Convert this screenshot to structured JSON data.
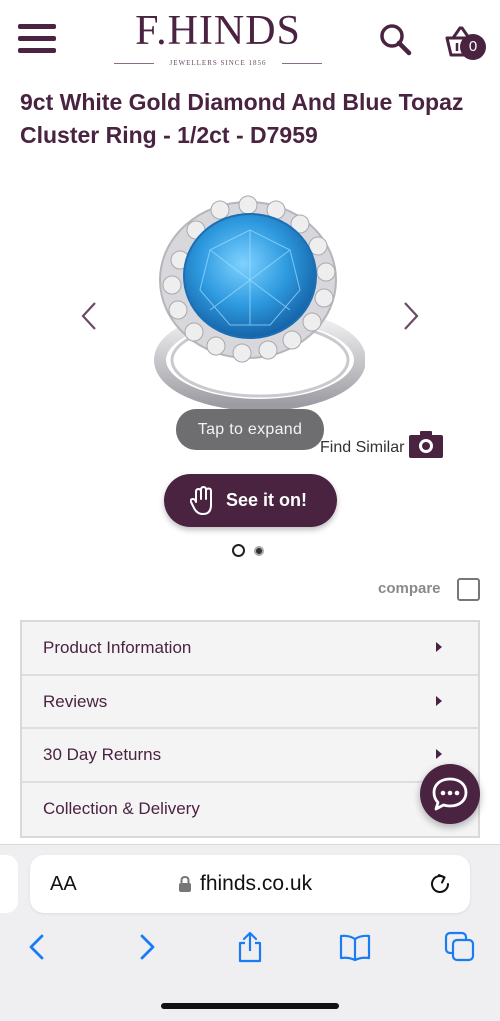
{
  "header": {
    "logo_main": "F.HINDS",
    "logo_sub": "JEWELLERS SINCE 1856",
    "basket_count": "0"
  },
  "product": {
    "title": "9ct White Gold Diamond And Blue Topaz Cluster Ring - 1/2ct - D7959"
  },
  "gallery": {
    "tap_to_expand": "Tap to expand",
    "find_similar": "Find Similar",
    "see_it_on": "See it on!",
    "slide_count": 2,
    "active_slide": 1
  },
  "compare": {
    "label": "compare",
    "checked": false
  },
  "accordion": {
    "items": [
      {
        "label": "Product Information"
      },
      {
        "label": "Reviews"
      },
      {
        "label": "30 Day Returns"
      },
      {
        "label": "Collection & Delivery"
      }
    ]
  },
  "browser": {
    "text_size_label": "AA",
    "url": "fhinds.co.uk",
    "toolbar_icons": [
      "back-icon",
      "forward-icon",
      "share-icon",
      "bookmarks-icon",
      "tabs-icon"
    ]
  },
  "colors": {
    "brand": "#4a2341",
    "topaz": "#2f9be0",
    "tap_pill": "#6e6e70"
  }
}
